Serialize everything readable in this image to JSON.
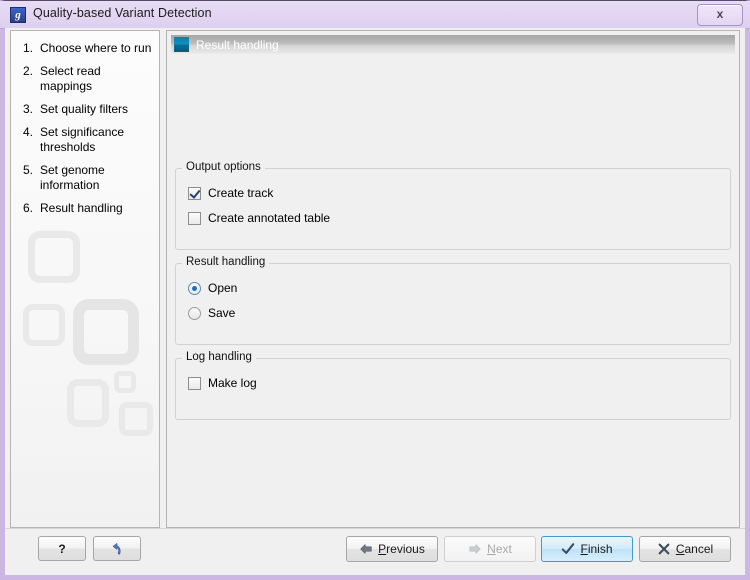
{
  "window": {
    "title": "Quality-based Variant Detection",
    "app_icon": "app-g-icon",
    "close_label": "x"
  },
  "sidebar": {
    "items": [
      {
        "num": "1.",
        "label": "Choose where to run"
      },
      {
        "num": "2.",
        "label": "Select read mappings"
      },
      {
        "num": "3.",
        "label": "Set quality filters"
      },
      {
        "num": "4.",
        "label": "Set significance thresholds"
      },
      {
        "num": "5.",
        "label": "Set genome information"
      },
      {
        "num": "6.",
        "label": "Result handling"
      }
    ]
  },
  "panel": {
    "header_title": "Result handling",
    "header_icon": "result-handling-icon",
    "groups": {
      "output": {
        "title": "Output options",
        "create_track": {
          "label": "Create track",
          "checked": true
        },
        "create_annotated_table": {
          "label": "Create annotated table",
          "checked": false
        }
      },
      "result": {
        "title": "Result handling",
        "open": {
          "label": "Open",
          "selected": true
        },
        "save": {
          "label": "Save",
          "selected": false
        }
      },
      "log": {
        "title": "Log handling",
        "make_log": {
          "label": "Make log",
          "checked": false
        }
      }
    }
  },
  "buttons": {
    "help": "?",
    "reset": "",
    "previous": "Previous",
    "next": "Next",
    "finish": "Finish",
    "cancel": "Cancel"
  },
  "colors": {
    "titlebar": "#e3d6f3",
    "window_border": "#cbb6e4",
    "panel_bg": "#f0f0f0",
    "header_icon": "#0d8fbe",
    "finish_border": "#3f9ad4",
    "radio_dot": "#1f6ead"
  }
}
